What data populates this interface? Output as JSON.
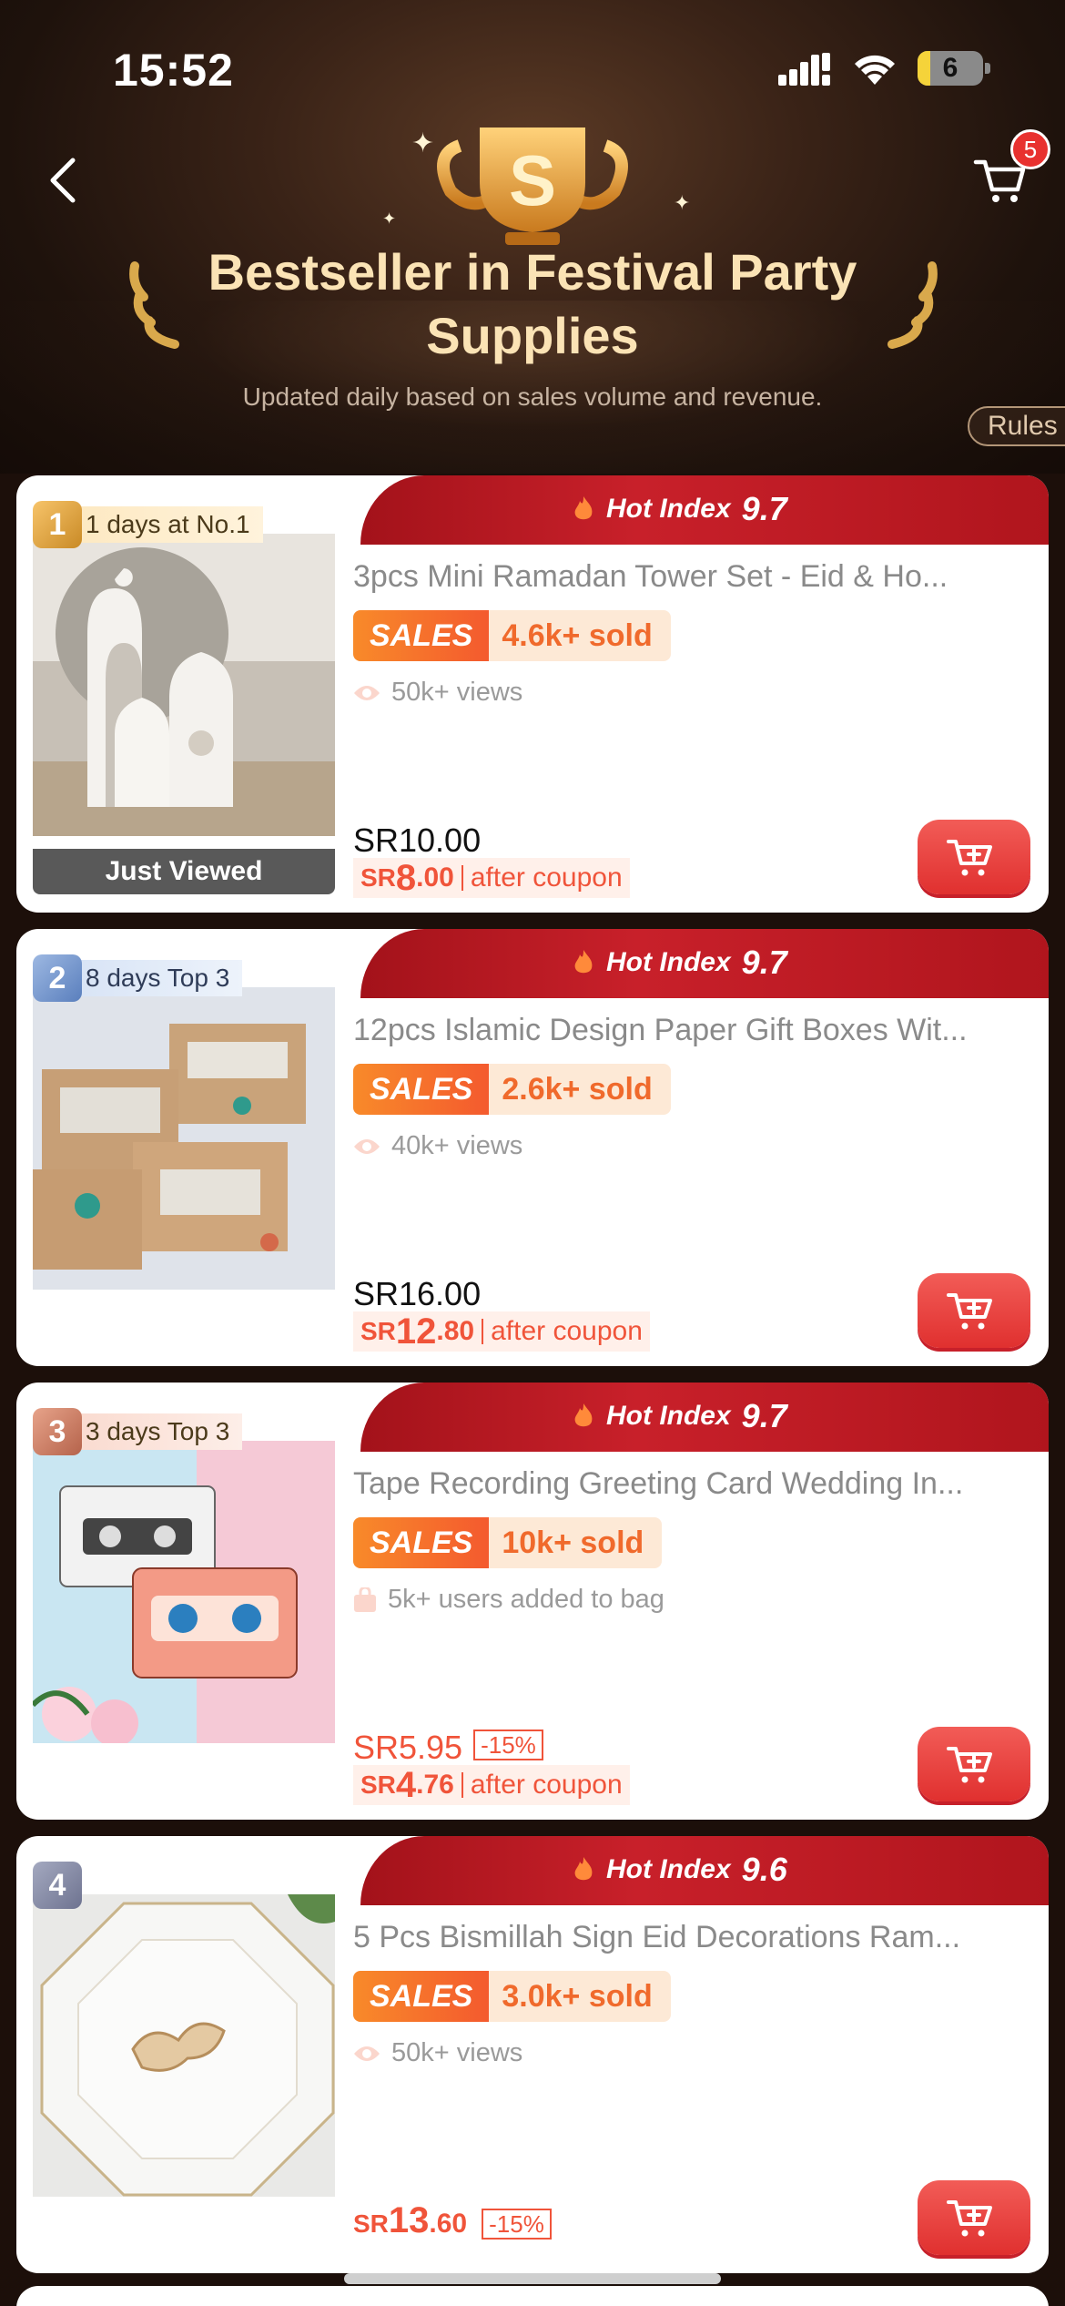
{
  "status_bar": {
    "time": "15:52",
    "battery": "6"
  },
  "header": {
    "title": "Bestseller in Festival Party Supplies",
    "subtitle": "Updated daily based on sales volume and revenue.",
    "rules_label": "Rules",
    "cart_count": "5",
    "trophy_letter": "S"
  },
  "colors": {
    "accent_red": "#c8202a",
    "sales_orange": "#f06a2c",
    "price_red": "#f0543a",
    "title_gold": "#fbe3b5"
  },
  "products": [
    {
      "rank": "1",
      "rank_label": "1 days at No.1",
      "hot_index_label": "Hot Index",
      "hot_index": "9.7",
      "name": "3pcs Mini Ramadan Tower Set - Eid & Ho...",
      "sales_tag": "SALES",
      "sold": "4.6k+ sold",
      "meta_icon": "eye-icon",
      "meta": "50k+ views",
      "price": "SR10.00",
      "coupon_currency": "SR",
      "coupon_int": "8",
      "coupon_dec": ".00",
      "coupon_label": "after coupon",
      "just_viewed": "Just Viewed"
    },
    {
      "rank": "2",
      "rank_label": "8 days Top 3",
      "hot_index_label": "Hot Index",
      "hot_index": "9.7",
      "name": "12pcs Islamic Design Paper Gift Boxes Wit...",
      "sales_tag": "SALES",
      "sold": "2.6k+ sold",
      "meta_icon": "eye-icon",
      "meta": "40k+ views",
      "price": "SR16.00",
      "coupon_currency": "SR",
      "coupon_int": "12",
      "coupon_dec": ".80",
      "coupon_label": "after coupon"
    },
    {
      "rank": "3",
      "rank_label": "3 days Top 3",
      "hot_index_label": "Hot Index",
      "hot_index": "9.7",
      "name": "Tape Recording Greeting Card Wedding In...",
      "sales_tag": "SALES",
      "sold": "10k+ sold",
      "meta_icon": "bag-icon",
      "meta": "5k+ users added to bag",
      "price": "SR5.95",
      "discount": "-15%",
      "coupon_currency": "SR",
      "coupon_int": "4",
      "coupon_dec": ".76",
      "coupon_label": "after coupon"
    },
    {
      "rank": "4",
      "hot_index_label": "Hot Index",
      "hot_index": "9.6",
      "name": "5 Pcs Bismillah Sign Eid Decorations Ram...",
      "sales_tag": "SALES",
      "sold": "3.0k+ sold",
      "meta_icon": "eye-icon",
      "meta": "50k+ views",
      "final_currency": "SR",
      "final_int": "13",
      "final_dec": ".60",
      "discount": "-15%"
    }
  ]
}
